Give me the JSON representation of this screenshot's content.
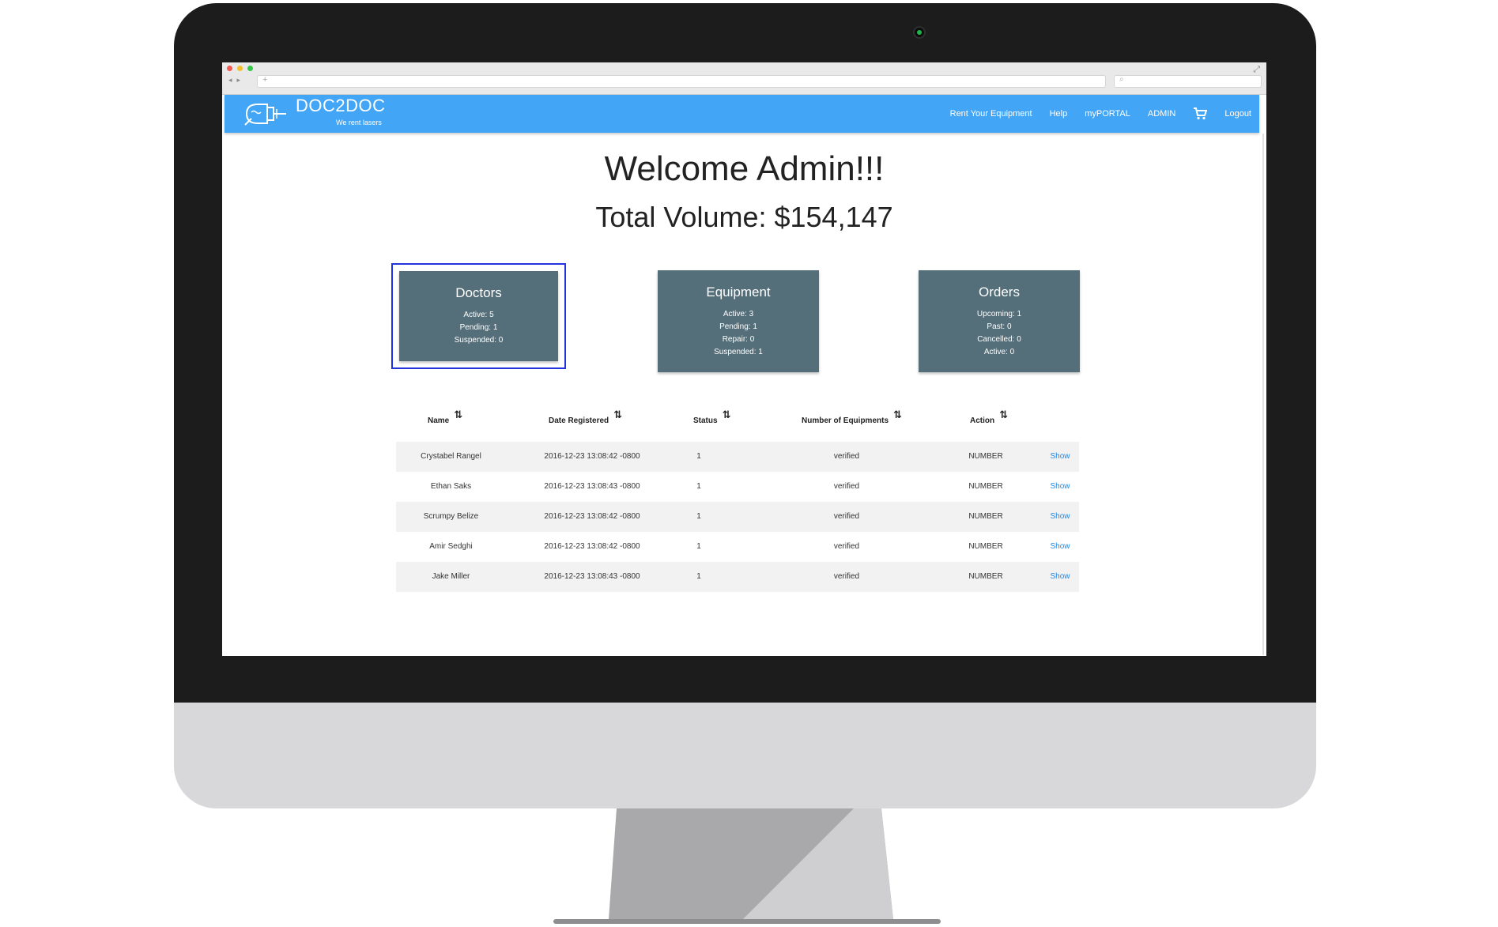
{
  "brand": {
    "name": "DOC2DOC",
    "tagline": "We rent lasers"
  },
  "nav": {
    "items": [
      {
        "label": "Rent Your Equipment"
      },
      {
        "label": "Help"
      },
      {
        "label": "myPORTAL"
      },
      {
        "label": "ADMIN"
      }
    ],
    "cart_icon": "shopping-cart-icon",
    "logout_label": "Logout"
  },
  "header": {
    "welcome": "Welcome Admin!!!",
    "total_volume": "Total Volume: $154,147"
  },
  "cards": {
    "doctors": {
      "title": "Doctors",
      "lines": [
        "Active: 5",
        "Pending: 1",
        "Suspended: 0"
      ]
    },
    "equipment": {
      "title": "Equipment",
      "lines": [
        "Active: 3",
        "Pending: 1",
        "Repair: 0",
        "Suspended: 1"
      ]
    },
    "orders": {
      "title": "Orders",
      "lines": [
        "Upcoming: 1",
        "Past: 0",
        "Cancelled: 0",
        "Active: 0"
      ]
    }
  },
  "table": {
    "columns": [
      "Name",
      "Date Registered",
      "Status",
      "Number of Equipments",
      "Action"
    ],
    "rows": [
      {
        "name": "Crystabel Rangel",
        "date": "2016-12-23 13:08:42 -0800",
        "status": "1",
        "equipments": "verified",
        "action": "NUMBER",
        "link": "Show"
      },
      {
        "name": "Ethan Saks",
        "date": "2016-12-23 13:08:43 -0800",
        "status": "1",
        "equipments": "verified",
        "action": "NUMBER",
        "link": "Show"
      },
      {
        "name": "Scrumpy Belize",
        "date": "2016-12-23 13:08:42 -0800",
        "status": "1",
        "equipments": "verified",
        "action": "NUMBER",
        "link": "Show"
      },
      {
        "name": "Amir Sedghi",
        "date": "2016-12-23 13:08:42 -0800",
        "status": "1",
        "equipments": "verified",
        "action": "NUMBER",
        "link": "Show"
      },
      {
        "name": "Jake Miller",
        "date": "2016-12-23 13:08:43 -0800",
        "status": "1",
        "equipments": "verified",
        "action": "NUMBER",
        "link": "Show"
      }
    ]
  },
  "colors": {
    "appbar": "#42a5f5",
    "card": "#546e7a",
    "link": "#1e88e5",
    "selection_outline": "#2233dd"
  }
}
